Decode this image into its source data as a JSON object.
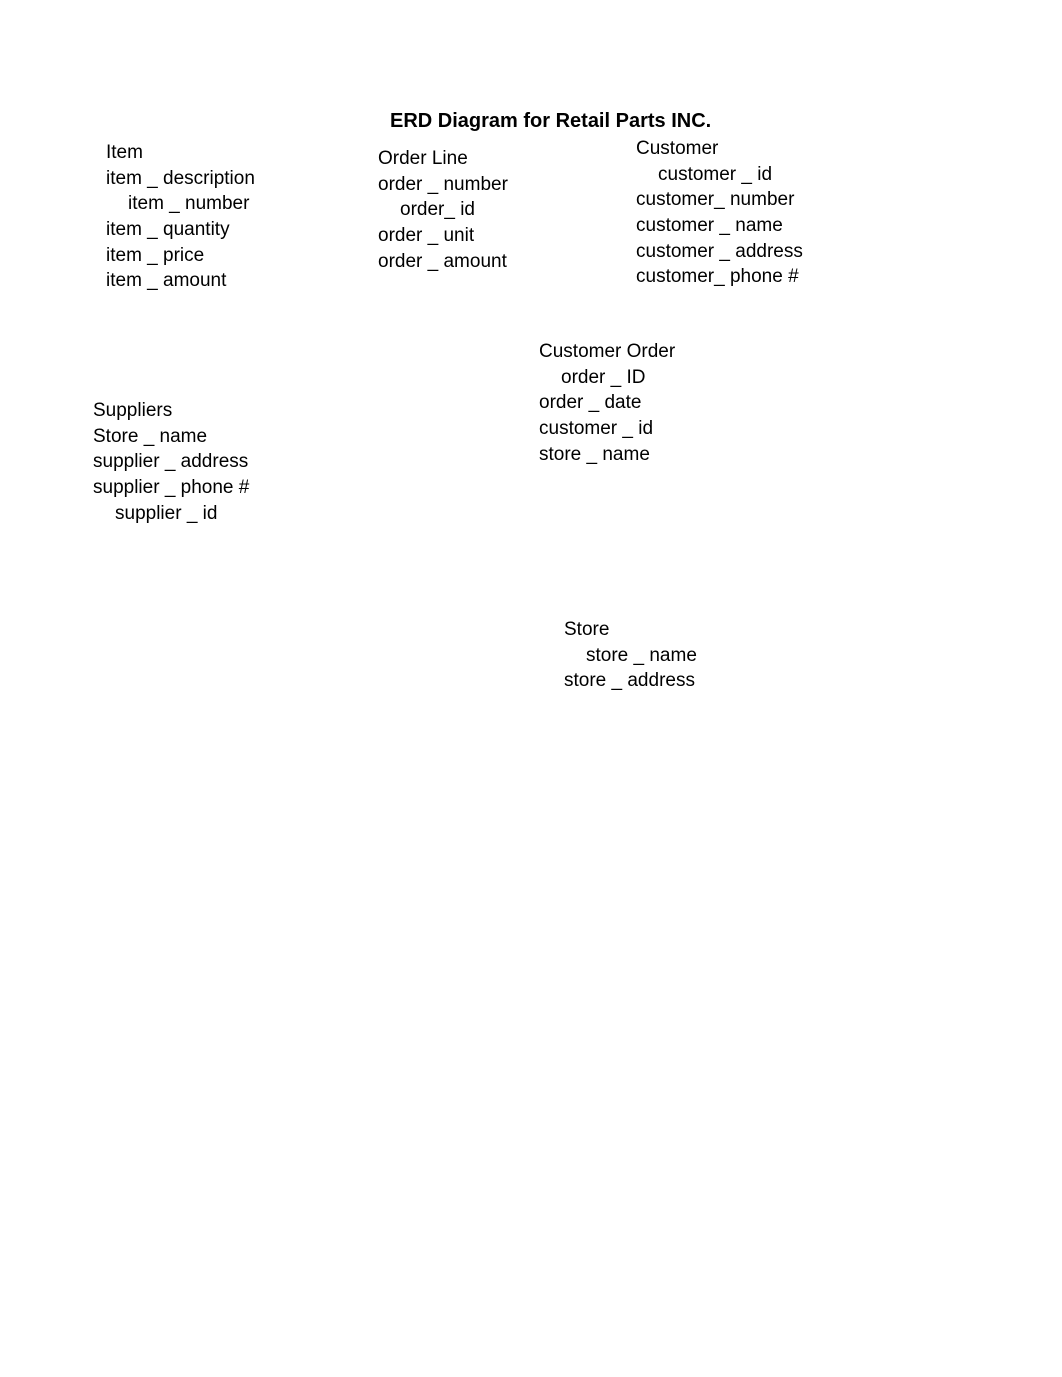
{
  "title": "ERD Diagram for Retail Parts INC.",
  "entities": {
    "item": {
      "name": "Item",
      "attrs": [
        "item _ description",
        "item _ number",
        "item _ quantity",
        "item _ price",
        "item _ amount"
      ]
    },
    "orderLine": {
      "name": "Order Line",
      "attrs": [
        "order _ number",
        "order_ id",
        "order _ unit",
        "order _ amount"
      ]
    },
    "customer": {
      "name": "Customer",
      "attrs": [
        "customer _ id",
        "customer_ number",
        "customer _ name",
        "customer _ address",
        "customer_ phone #"
      ]
    },
    "customerOrder": {
      "name": "Customer Order",
      "attrs": [
        "order _ ID",
        "order _ date",
        "customer _ id",
        "store _ name"
      ]
    },
    "suppliers": {
      "name": "Suppliers",
      "attrs": [
        "Store _ name",
        "supplier _ address",
        "supplier _ phone #",
        "supplier _ id"
      ]
    },
    "store": {
      "name": "Store",
      "attrs": [
        "store _ name",
        "store _ address"
      ]
    }
  }
}
